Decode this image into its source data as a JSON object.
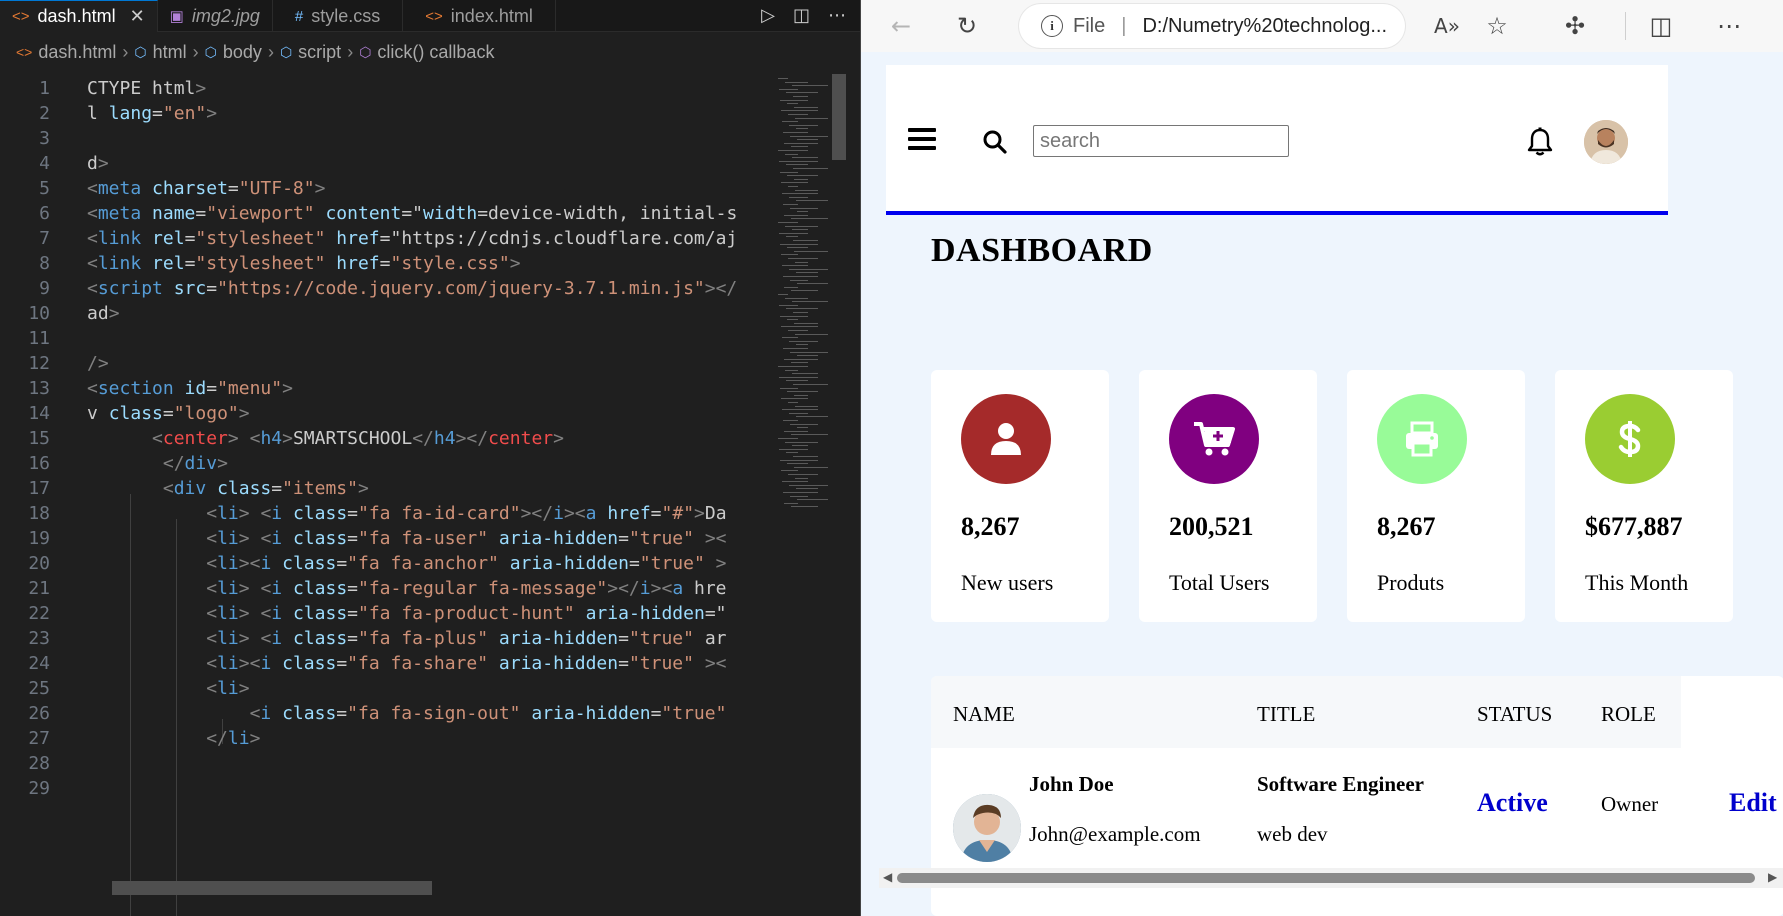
{
  "editor": {
    "tabs": [
      {
        "label": "dash.html",
        "icon": "<>",
        "active": true
      },
      {
        "label": "img2.jpg",
        "icon": "▣",
        "active": false
      },
      {
        "label": "style.css",
        "icon": "#",
        "active": false
      },
      {
        "label": "index.html",
        "icon": "<>",
        "active": false
      }
    ],
    "breadcrumb": [
      "dash.html",
      "html",
      "body",
      "script",
      "click() callback"
    ],
    "lines": [
      {
        "n": "1",
        "code": "CTYPE html>"
      },
      {
        "n": "2",
        "code": "l lang=\"en\">"
      },
      {
        "n": "3",
        "code": ""
      },
      {
        "n": "4",
        "code": "d>"
      },
      {
        "n": "5",
        "code": "<meta charset=\"UTF-8\">"
      },
      {
        "n": "6",
        "code": "<meta name=\"viewport\" content=\"width=device-width, initial-s"
      },
      {
        "n": "7",
        "code": "<link rel=\"stylesheet\" href=\"https://cdnjs.cloudflare.com/aj"
      },
      {
        "n": "8",
        "code": "<link rel=\"stylesheet\" href=\"style.css\">"
      },
      {
        "n": "9",
        "code": "<script src=\"https://code.jquery.com/jquery-3.7.1.min.js\"></"
      },
      {
        "n": "10",
        "code": "ad>"
      },
      {
        "n": "11",
        "code": ""
      },
      {
        "n": "12",
        "code": "/>"
      },
      {
        "n": "13",
        "code": "<section id=\"menu\">"
      },
      {
        "n": "14",
        "code": "v class=\"logo\">"
      },
      {
        "n": "15",
        "code": "      <center> <h4>SMARTSCHOOL</h4></center>"
      },
      {
        "n": "16",
        "code": "       </div>"
      },
      {
        "n": "17",
        "code": "       <div class=\"items\">"
      },
      {
        "n": "18",
        "code": "           <li> <i class=\"fa fa-id-card\"></i><a href=\"#\">Da"
      },
      {
        "n": "19",
        "code": "           <li> <i class=\"fa fa-user\" aria-hidden=\"true\" ><"
      },
      {
        "n": "20",
        "code": "           <li><i class=\"fa fa-anchor\" aria-hidden=\"true\" >"
      },
      {
        "n": "21",
        "code": "           <li> <i class=\"fa-regular fa-message\"></i><a hre"
      },
      {
        "n": "22",
        "code": "           <li> <i class=\"fa fa-product-hunt\" aria-hidden=\""
      },
      {
        "n": "23",
        "code": "           <li> <i class=\"fa fa-plus\" aria-hidden=\"true\" ar"
      },
      {
        "n": "24",
        "code": "           <li><i class=\"fa fa-share\" aria-hidden=\"true\" ><"
      },
      {
        "n": "25",
        "code": "           <li>"
      },
      {
        "n": "26",
        "code": "               <i class=\"fa fa-sign-out\" aria-hidden=\"true\""
      },
      {
        "n": "27",
        "code": "           </li>"
      },
      {
        "n": "28",
        "code": ""
      },
      {
        "n": "29",
        "code": ""
      }
    ]
  },
  "browser": {
    "address": {
      "scheme_label": "File",
      "url": "D:/Numetry%20technolog..."
    },
    "nav": {
      "search_placeholder": "search"
    },
    "page_title": "DASHBOARD",
    "cards": [
      {
        "value": "8,267",
        "label": "New users",
        "color": "#a52a2a",
        "icon": "user-icon"
      },
      {
        "value": "200,521",
        "label": "Total Users",
        "color": "#800080",
        "icon": "cart-plus-icon"
      },
      {
        "value": "8,267",
        "label": "Produts",
        "color": "#98fb98",
        "icon": "printer-icon"
      },
      {
        "value": "$677,887",
        "label": "This Month",
        "color": "#9acd32",
        "icon": "dollar-icon"
      }
    ],
    "table": {
      "headers": [
        "NAME",
        "TITLE",
        "STATUS",
        "ROLE"
      ],
      "rows": [
        {
          "name": "John Doe",
          "email": "John@example.com",
          "title": "Software Engineer",
          "subtitle": "web dev",
          "status": "Active",
          "role": "Owner",
          "action": "Edit"
        }
      ]
    }
  }
}
